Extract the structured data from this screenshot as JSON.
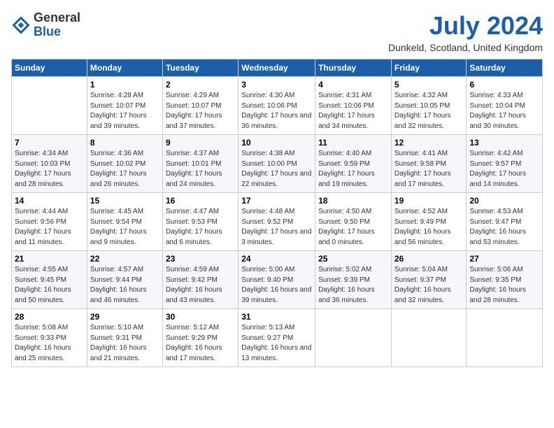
{
  "header": {
    "logo": {
      "general": "General",
      "blue": "Blue"
    },
    "month_year": "July 2024",
    "location": "Dunkeld, Scotland, United Kingdom"
  },
  "days_of_week": [
    "Sunday",
    "Monday",
    "Tuesday",
    "Wednesday",
    "Thursday",
    "Friday",
    "Saturday"
  ],
  "weeks": [
    [
      {
        "day": "",
        "info": ""
      },
      {
        "day": "1",
        "info": "Sunrise: 4:28 AM\nSunset: 10:07 PM\nDaylight: 17 hours\nand 39 minutes."
      },
      {
        "day": "2",
        "info": "Sunrise: 4:29 AM\nSunset: 10:07 PM\nDaylight: 17 hours\nand 37 minutes."
      },
      {
        "day": "3",
        "info": "Sunrise: 4:30 AM\nSunset: 10:06 PM\nDaylight: 17 hours\nand 36 minutes."
      },
      {
        "day": "4",
        "info": "Sunrise: 4:31 AM\nSunset: 10:06 PM\nDaylight: 17 hours\nand 34 minutes."
      },
      {
        "day": "5",
        "info": "Sunrise: 4:32 AM\nSunset: 10:05 PM\nDaylight: 17 hours\nand 32 minutes."
      },
      {
        "day": "6",
        "info": "Sunrise: 4:33 AM\nSunset: 10:04 PM\nDaylight: 17 hours\nand 30 minutes."
      }
    ],
    [
      {
        "day": "7",
        "info": "Sunrise: 4:34 AM\nSunset: 10:03 PM\nDaylight: 17 hours\nand 28 minutes."
      },
      {
        "day": "8",
        "info": "Sunrise: 4:36 AM\nSunset: 10:02 PM\nDaylight: 17 hours\nand 26 minutes."
      },
      {
        "day": "9",
        "info": "Sunrise: 4:37 AM\nSunset: 10:01 PM\nDaylight: 17 hours\nand 24 minutes."
      },
      {
        "day": "10",
        "info": "Sunrise: 4:38 AM\nSunset: 10:00 PM\nDaylight: 17 hours\nand 22 minutes."
      },
      {
        "day": "11",
        "info": "Sunrise: 4:40 AM\nSunset: 9:59 PM\nDaylight: 17 hours\nand 19 minutes."
      },
      {
        "day": "12",
        "info": "Sunrise: 4:41 AM\nSunset: 9:58 PM\nDaylight: 17 hours\nand 17 minutes."
      },
      {
        "day": "13",
        "info": "Sunrise: 4:42 AM\nSunset: 9:57 PM\nDaylight: 17 hours\nand 14 minutes."
      }
    ],
    [
      {
        "day": "14",
        "info": "Sunrise: 4:44 AM\nSunset: 9:56 PM\nDaylight: 17 hours\nand 11 minutes."
      },
      {
        "day": "15",
        "info": "Sunrise: 4:45 AM\nSunset: 9:54 PM\nDaylight: 17 hours\nand 9 minutes."
      },
      {
        "day": "16",
        "info": "Sunrise: 4:47 AM\nSunset: 9:53 PM\nDaylight: 17 hours\nand 6 minutes."
      },
      {
        "day": "17",
        "info": "Sunrise: 4:48 AM\nSunset: 9:52 PM\nDaylight: 17 hours\nand 3 minutes."
      },
      {
        "day": "18",
        "info": "Sunrise: 4:50 AM\nSunset: 9:50 PM\nDaylight: 17 hours\nand 0 minutes."
      },
      {
        "day": "19",
        "info": "Sunrise: 4:52 AM\nSunset: 9:49 PM\nDaylight: 16 hours\nand 56 minutes."
      },
      {
        "day": "20",
        "info": "Sunrise: 4:53 AM\nSunset: 9:47 PM\nDaylight: 16 hours\nand 53 minutes."
      }
    ],
    [
      {
        "day": "21",
        "info": "Sunrise: 4:55 AM\nSunset: 9:45 PM\nDaylight: 16 hours\nand 50 minutes."
      },
      {
        "day": "22",
        "info": "Sunrise: 4:57 AM\nSunset: 9:44 PM\nDaylight: 16 hours\nand 46 minutes."
      },
      {
        "day": "23",
        "info": "Sunrise: 4:59 AM\nSunset: 9:42 PM\nDaylight: 16 hours\nand 43 minutes."
      },
      {
        "day": "24",
        "info": "Sunrise: 5:00 AM\nSunset: 9:40 PM\nDaylight: 16 hours\nand 39 minutes."
      },
      {
        "day": "25",
        "info": "Sunrise: 5:02 AM\nSunset: 9:39 PM\nDaylight: 16 hours\nand 36 minutes."
      },
      {
        "day": "26",
        "info": "Sunrise: 5:04 AM\nSunset: 9:37 PM\nDaylight: 16 hours\nand 32 minutes."
      },
      {
        "day": "27",
        "info": "Sunrise: 5:06 AM\nSunset: 9:35 PM\nDaylight: 16 hours\nand 28 minutes."
      }
    ],
    [
      {
        "day": "28",
        "info": "Sunrise: 5:08 AM\nSunset: 9:33 PM\nDaylight: 16 hours\nand 25 minutes."
      },
      {
        "day": "29",
        "info": "Sunrise: 5:10 AM\nSunset: 9:31 PM\nDaylight: 16 hours\nand 21 minutes."
      },
      {
        "day": "30",
        "info": "Sunrise: 5:12 AM\nSunset: 9:29 PM\nDaylight: 16 hours\nand 17 minutes."
      },
      {
        "day": "31",
        "info": "Sunrise: 5:13 AM\nSunset: 9:27 PM\nDaylight: 16 hours\nand 13 minutes."
      },
      {
        "day": "",
        "info": ""
      },
      {
        "day": "",
        "info": ""
      },
      {
        "day": "",
        "info": ""
      }
    ]
  ]
}
